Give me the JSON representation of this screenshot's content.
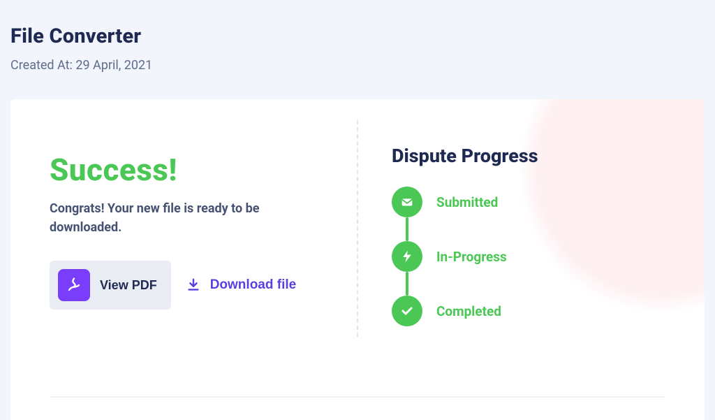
{
  "page": {
    "title": "File Converter",
    "meta_prefix": "Created At: ",
    "created_at": "29 April, 2021"
  },
  "success": {
    "heading": "Success!",
    "message": "Congrats! Your new file is ready to be downloaded.",
    "view_label": "View PDF",
    "download_label": "Download file"
  },
  "progress": {
    "title": "Dispute Progress",
    "steps": [
      {
        "label": "Submitted"
      },
      {
        "label": "In-Progress"
      },
      {
        "label": "Completed"
      }
    ]
  },
  "colors": {
    "green": "#4bc756",
    "purple": "#7a3dfb",
    "indigo": "#5c3fe0",
    "text": "#1f2a52",
    "muted": "#5f6d8c",
    "bg": "#f2f5fb",
    "card": "#ffffff",
    "buttonbg": "#e9ecf3"
  }
}
